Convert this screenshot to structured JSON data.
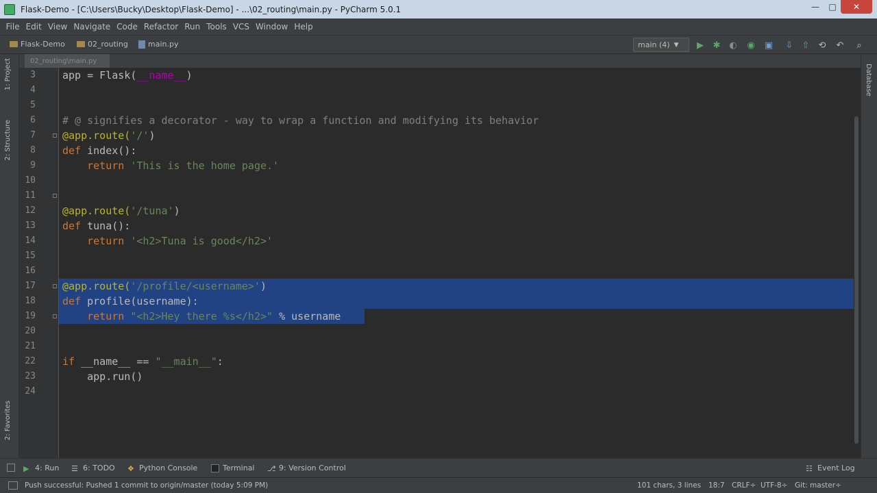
{
  "window": {
    "title": "Flask-Demo - [C:\\Users\\Bucky\\Desktop\\Flask-Demo] - ...\\02_routing\\main.py - PyCharm 5.0.1",
    "minimize": "—",
    "maximize": "□",
    "close": "✕"
  },
  "menu": [
    "File",
    "Edit",
    "View",
    "Navigate",
    "Code",
    "Refactor",
    "Run",
    "Tools",
    "VCS",
    "Window",
    "Help"
  ],
  "breadcrumb": [
    "Flask-Demo",
    "02_routing",
    "main.py"
  ],
  "run_config": "main (4)",
  "toolbar_icons": [
    "run-icon",
    "debug-icon",
    "coverage-icon",
    "profile-icon",
    "vcs-update-icon",
    "vcs-commit-icon",
    "settings-icon",
    "sdk-icon",
    "undo-icon",
    "search-icon"
  ],
  "tab": {
    "label": "02_routing\\main.py"
  },
  "left_tools": [
    "1: Project",
    "2: Structure",
    "2: Favorites"
  ],
  "right_tools": [
    "Database"
  ],
  "code": {
    "line_numbers": [
      "3",
      "4",
      "5",
      "6",
      "7",
      "8",
      "9",
      "10",
      "11",
      "12",
      "13",
      "14",
      "15",
      "16",
      "17",
      "18",
      "19",
      "20",
      "21",
      "22",
      "23",
      "24"
    ],
    "lines": [
      [
        {
          "t": "app = Flask(",
          "c": "p"
        },
        {
          "t": "__name__",
          "c": "dn"
        },
        {
          "t": ")",
          "c": "p"
        }
      ],
      [],
      [],
      [
        {
          "t": "# @ signifies a decorator - way to wrap a function and modifying its behavior",
          "c": "cm"
        }
      ],
      [
        {
          "t": "@app.route(",
          "c": "dec"
        },
        {
          "t": "'/'",
          "c": "str"
        },
        {
          "t": ")",
          "c": "p"
        }
      ],
      [
        {
          "t": "def ",
          "c": "kw"
        },
        {
          "t": "index():",
          "c": "p"
        }
      ],
      [
        {
          "t": "    return ",
          "c": "kw"
        },
        {
          "t": "'This is the home page.'",
          "c": "str"
        }
      ],
      [],
      [],
      [
        {
          "t": "@app.route(",
          "c": "dec"
        },
        {
          "t": "'/tuna'",
          "c": "str"
        },
        {
          "t": ")",
          "c": "p"
        }
      ],
      [
        {
          "t": "def ",
          "c": "kw"
        },
        {
          "t": "tuna():",
          "c": "p"
        }
      ],
      [
        {
          "t": "    return ",
          "c": "kw"
        },
        {
          "t": "'<h2>Tuna is good</h2>'",
          "c": "str"
        }
      ],
      [],
      [],
      [
        {
          "t": "@app.route(",
          "c": "dec"
        },
        {
          "t": "'/profile/<username>'",
          "c": "str"
        },
        {
          "t": ")",
          "c": "p"
        }
      ],
      [
        {
          "t": "def ",
          "c": "kw"
        },
        {
          "t": "profile(username):",
          "c": "p"
        }
      ],
      [
        {
          "t": "    return ",
          "c": "kw"
        },
        {
          "t": "\"<h2>Hey there %s</h2>\"",
          "c": "str"
        },
        {
          "t": " % username",
          "c": "p"
        }
      ],
      [],
      [],
      [
        {
          "t": "if ",
          "c": "kw"
        },
        {
          "t": "__name__ == ",
          "c": "p"
        },
        {
          "t": "\"__main__\"",
          "c": "str"
        },
        {
          "t": ":",
          "c": "p"
        }
      ],
      [
        {
          "t": "    app.run()",
          "c": "p"
        }
      ],
      []
    ],
    "selected_lines": [
      14,
      15,
      16
    ]
  },
  "bottom_tools": [
    "4: Run",
    "6: TODO",
    "Python Console",
    "Terminal",
    "9: Version Control",
    "Event Log"
  ],
  "status": {
    "message": "Push successful: Pushed 1 commit to origin/master (today 5:09 PM)",
    "chars": "101 chars, 3 lines",
    "position": "18:7",
    "line_sep": "CRLF÷",
    "encoding": "UTF-8÷",
    "git": "Git: master÷"
  },
  "colors": {
    "keyword": "#cc7832",
    "string": "#6a8759",
    "comment": "#808080",
    "decorator": "#bbb529",
    "selection": "#214283"
  }
}
